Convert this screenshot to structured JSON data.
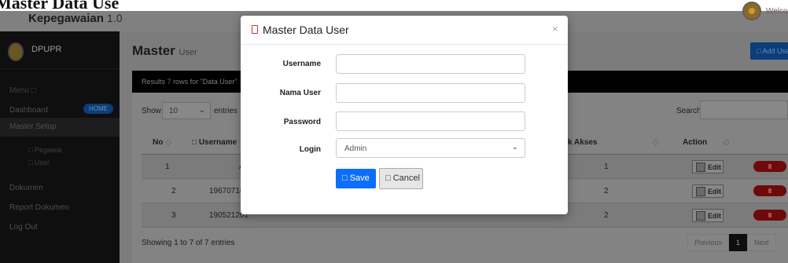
{
  "page_heading": "Master Data Use",
  "navbar": {
    "brand": "Kepegawaian",
    "version": "1.0",
    "welcome": "Welcom"
  },
  "sidebar": {
    "org": "DPUPR",
    "menu_title": "Menu □",
    "items": [
      {
        "label": "Dashboard",
        "badge": "HOME"
      },
      {
        "label": "Master Setup"
      },
      {
        "label": "Dokumen"
      },
      {
        "label": "Report Dokumen"
      },
      {
        "label": "Log Out"
      }
    ],
    "subitems": [
      "□ Pegawai",
      "□ User"
    ]
  },
  "content": {
    "title": "Master",
    "subtitle": "User",
    "add_button": "□ Add Use",
    "results": {
      "prefix": "Results",
      "count": "7",
      "suffix": "rows for \"Data User\""
    },
    "show_label": "Show",
    "length_value": "10",
    "entries_label": "entries",
    "search_label": "Search:",
    "table": {
      "headers": {
        "no": "No",
        "username": "□ Username",
        "akses": "k Akses",
        "action": "Action"
      },
      "rows": [
        {
          "no": "1",
          "username": "A",
          "akses": "1"
        },
        {
          "no": "2",
          "username": "19670716",
          "akses": "2"
        },
        {
          "no": "3",
          "username": "190521201",
          "akses": "2"
        }
      ],
      "edit_label": "Edit"
    },
    "footer_info": "Showing 1 to 7 of 7 entries",
    "pager": {
      "previous": "Previous",
      "current": "1",
      "next": "Next"
    }
  },
  "modal": {
    "title": "Master Data User",
    "close": "×",
    "fields": {
      "username_label": "Username",
      "nama_label": "Nama User",
      "password_label": "Password",
      "login_label": "Login",
      "login_value": "Admin"
    },
    "save_label": "□ Save",
    "cancel_label": "□ Cancel"
  },
  "colors": {
    "primary": "#0d6efd",
    "danger_icon": "#cc3333",
    "sidebar_bg": "#0f0f0f"
  }
}
